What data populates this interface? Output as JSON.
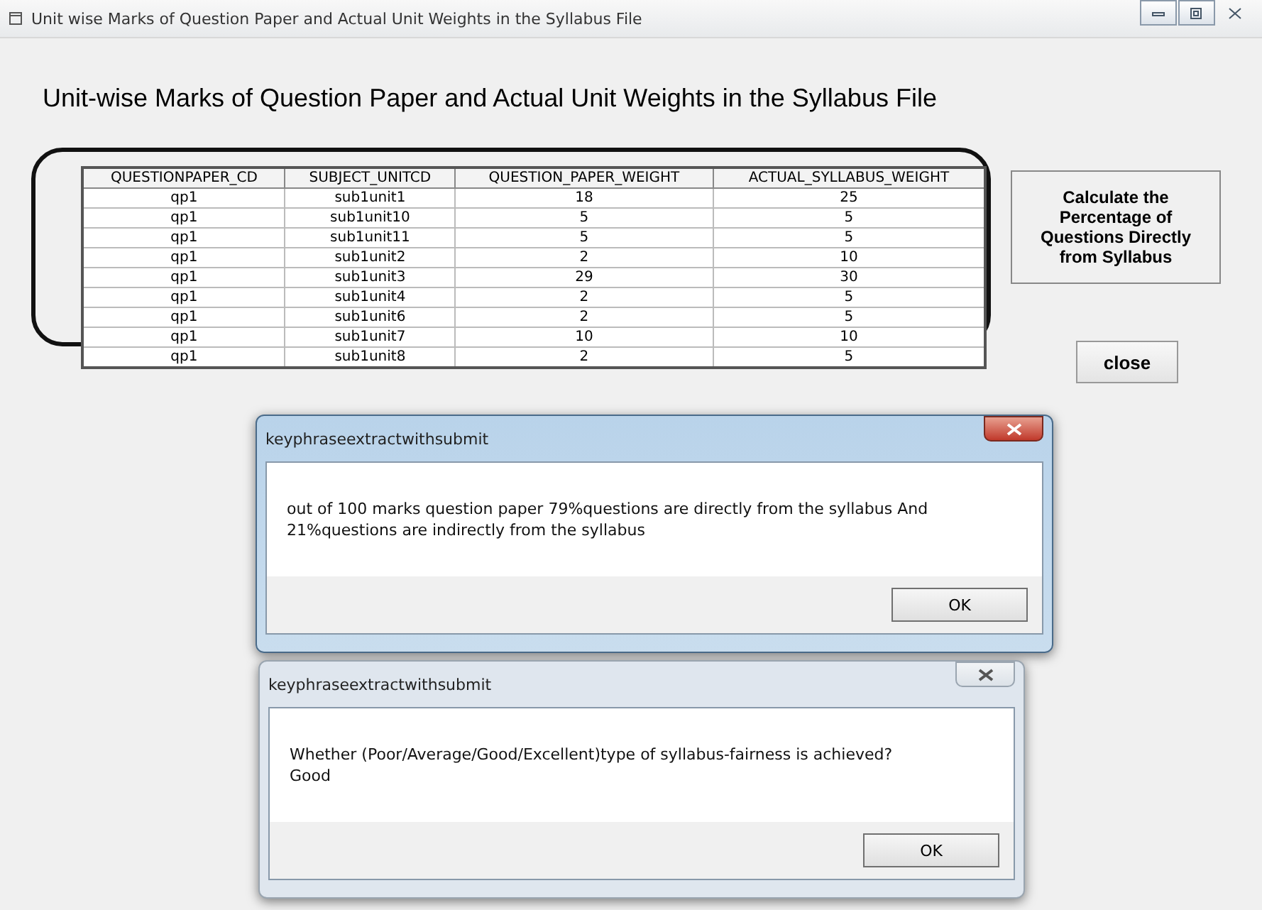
{
  "window": {
    "title": "Unit wise Marks of Question Paper and Actual Unit Weights in the Syllabus File"
  },
  "heading": "Unit-wise Marks of Question Paper and Actual Unit Weights in the Syllabus File",
  "table": {
    "columns": [
      "QUESTIONPAPER_CD",
      "SUBJECT_UNITCD",
      "QUESTION_PAPER_WEIGHT",
      "ACTUAL_SYLLABUS_WEIGHT"
    ],
    "rows": [
      [
        "qp1",
        "sub1unit1",
        "18",
        "25"
      ],
      [
        "qp1",
        "sub1unit10",
        "5",
        "5"
      ],
      [
        "qp1",
        "sub1unit11",
        "5",
        "5"
      ],
      [
        "qp1",
        "sub1unit2",
        "2",
        "10"
      ],
      [
        "qp1",
        "sub1unit3",
        "29",
        "30"
      ],
      [
        "qp1",
        "sub1unit4",
        "2",
        "5"
      ],
      [
        "qp1",
        "sub1unit6",
        "2",
        "5"
      ],
      [
        "qp1",
        "sub1unit7",
        "10",
        "10"
      ],
      [
        "qp1",
        "sub1unit8",
        "2",
        "5"
      ]
    ]
  },
  "buttons": [
    "Calculate the Percentage of Questions Directly from Syllabus",
    "close"
  ],
  "dialogs": [
    {
      "title": "keyphraseextractwithsubmit",
      "active": true,
      "message": [
        "out of 100 marks question paper 79%questions are directly from the syllabus And",
        "21%questions are indirectly from the syllabus"
      ],
      "button": "OK"
    },
    {
      "title": "keyphraseextractwithsubmit",
      "active": false,
      "message": [
        "Whether (Poor/Average/Good/Excellent)type of syllabus-fairness is achieved?",
        "Good"
      ],
      "button": "OK"
    }
  ]
}
